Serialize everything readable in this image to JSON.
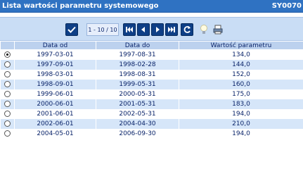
{
  "window": {
    "title": "Lista wartości parametru systemowego",
    "code": "SY0070"
  },
  "toolbar": {
    "pager_text": "1 - 10 / 10",
    "icons": [
      "confirm-icon",
      "first-page-icon",
      "previous-page-icon",
      "next-page-icon",
      "last-page-icon",
      "refresh-icon",
      "lightbulb-icon",
      "print-icon"
    ]
  },
  "table": {
    "headers": [
      "",
      "Data od",
      "Data do",
      "Wartość parametru"
    ],
    "rows": [
      {
        "selected": true,
        "od": "1997-03-01",
        "do": "1997-08-31",
        "value": "134,0"
      },
      {
        "selected": false,
        "od": "1997-09-01",
        "do": "1998-02-28",
        "value": "144,0"
      },
      {
        "selected": false,
        "od": "1998-03-01",
        "do": "1998-08-31",
        "value": "152,0"
      },
      {
        "selected": false,
        "od": "1998-09-01",
        "do": "1999-05-31",
        "value": "160,0"
      },
      {
        "selected": false,
        "od": "1999-06-01",
        "do": "2000-05-31",
        "value": "175,0"
      },
      {
        "selected": false,
        "od": "2000-06-01",
        "do": "2001-05-31",
        "value": "183,0"
      },
      {
        "selected": false,
        "od": "2001-06-01",
        "do": "2002-05-31",
        "value": "194,0"
      },
      {
        "selected": false,
        "od": "2002-06-01",
        "do": "2004-04-30",
        "value": "210,0"
      },
      {
        "selected": false,
        "od": "2004-05-01",
        "do": "2006-09-30",
        "value": "194,0"
      }
    ]
  }
}
